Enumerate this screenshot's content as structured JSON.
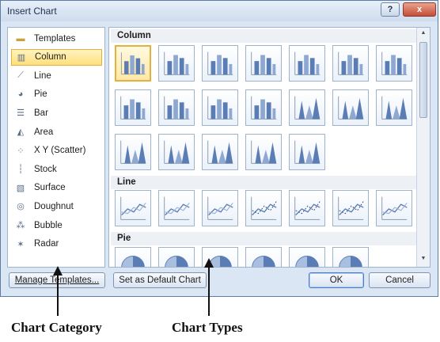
{
  "window": {
    "title": "Insert Chart",
    "help_button": "?",
    "close_button": "x"
  },
  "categories": [
    {
      "label": "Templates",
      "icon": "folder-icon",
      "selected": false
    },
    {
      "label": "Column",
      "icon": "column-chart-icon",
      "selected": true
    },
    {
      "label": "Line",
      "icon": "line-chart-icon",
      "selected": false
    },
    {
      "label": "Pie",
      "icon": "pie-chart-icon",
      "selected": false
    },
    {
      "label": "Bar",
      "icon": "bar-chart-icon",
      "selected": false
    },
    {
      "label": "Area",
      "icon": "area-chart-icon",
      "selected": false
    },
    {
      "label": "X Y (Scatter)",
      "icon": "scatter-chart-icon",
      "selected": false
    },
    {
      "label": "Stock",
      "icon": "stock-chart-icon",
      "selected": false
    },
    {
      "label": "Surface",
      "icon": "surface-chart-icon",
      "selected": false
    },
    {
      "label": "Doughnut",
      "icon": "doughnut-chart-icon",
      "selected": false
    },
    {
      "label": "Bubble",
      "icon": "bubble-chart-icon",
      "selected": false
    },
    {
      "label": "Radar",
      "icon": "radar-chart-icon",
      "selected": false
    }
  ],
  "gallery": {
    "sections": [
      {
        "title": "Column",
        "rows": [
          [
            "clustered-column-icon",
            "stacked-column-icon",
            "100-stacked-column-icon",
            "3d-clustered-column-icon",
            "3d-stacked-column-icon",
            "3d-100-stacked-column-icon",
            "3d-column-icon"
          ],
          [
            "clustered-cylinder-icon",
            "stacked-cylinder-icon",
            "100-stacked-cylinder-icon",
            "3d-cylinder-icon",
            "clustered-cone-icon",
            "stacked-cone-icon",
            "100-stacked-cone-icon"
          ],
          [
            "3d-cone-icon",
            "clustered-pyramid-icon",
            "stacked-pyramid-icon",
            "100-stacked-pyramid-icon",
            "3d-pyramid-icon"
          ]
        ]
      },
      {
        "title": "Line",
        "rows": [
          [
            "line-icon",
            "stacked-line-icon",
            "100-stacked-line-icon",
            "line-with-markers-icon",
            "stacked-line-with-markers-icon",
            "100-stacked-line-with-markers-icon",
            "3d-line-icon"
          ]
        ]
      },
      {
        "title": "Pie",
        "rows": [
          [
            "pie-icon",
            "3d-pie-icon",
            "pie-of-pie-icon",
            "exploded-pie-icon",
            "3d-exploded-pie-icon",
            "bar-of-pie-icon"
          ]
        ]
      }
    ]
  },
  "buttons": {
    "manage_templates": "Manage Templates...",
    "set_default": "Set as Default Chart",
    "ok": "OK",
    "cancel": "Cancel"
  },
  "annotations": {
    "left": "Chart Category",
    "right": "Chart Types"
  },
  "colors": {
    "selection": "#ffdf7a",
    "selection_border": "#e3b23c",
    "dialog_bg": "#dbe6f4",
    "chart_blue": "#5b7db5"
  }
}
